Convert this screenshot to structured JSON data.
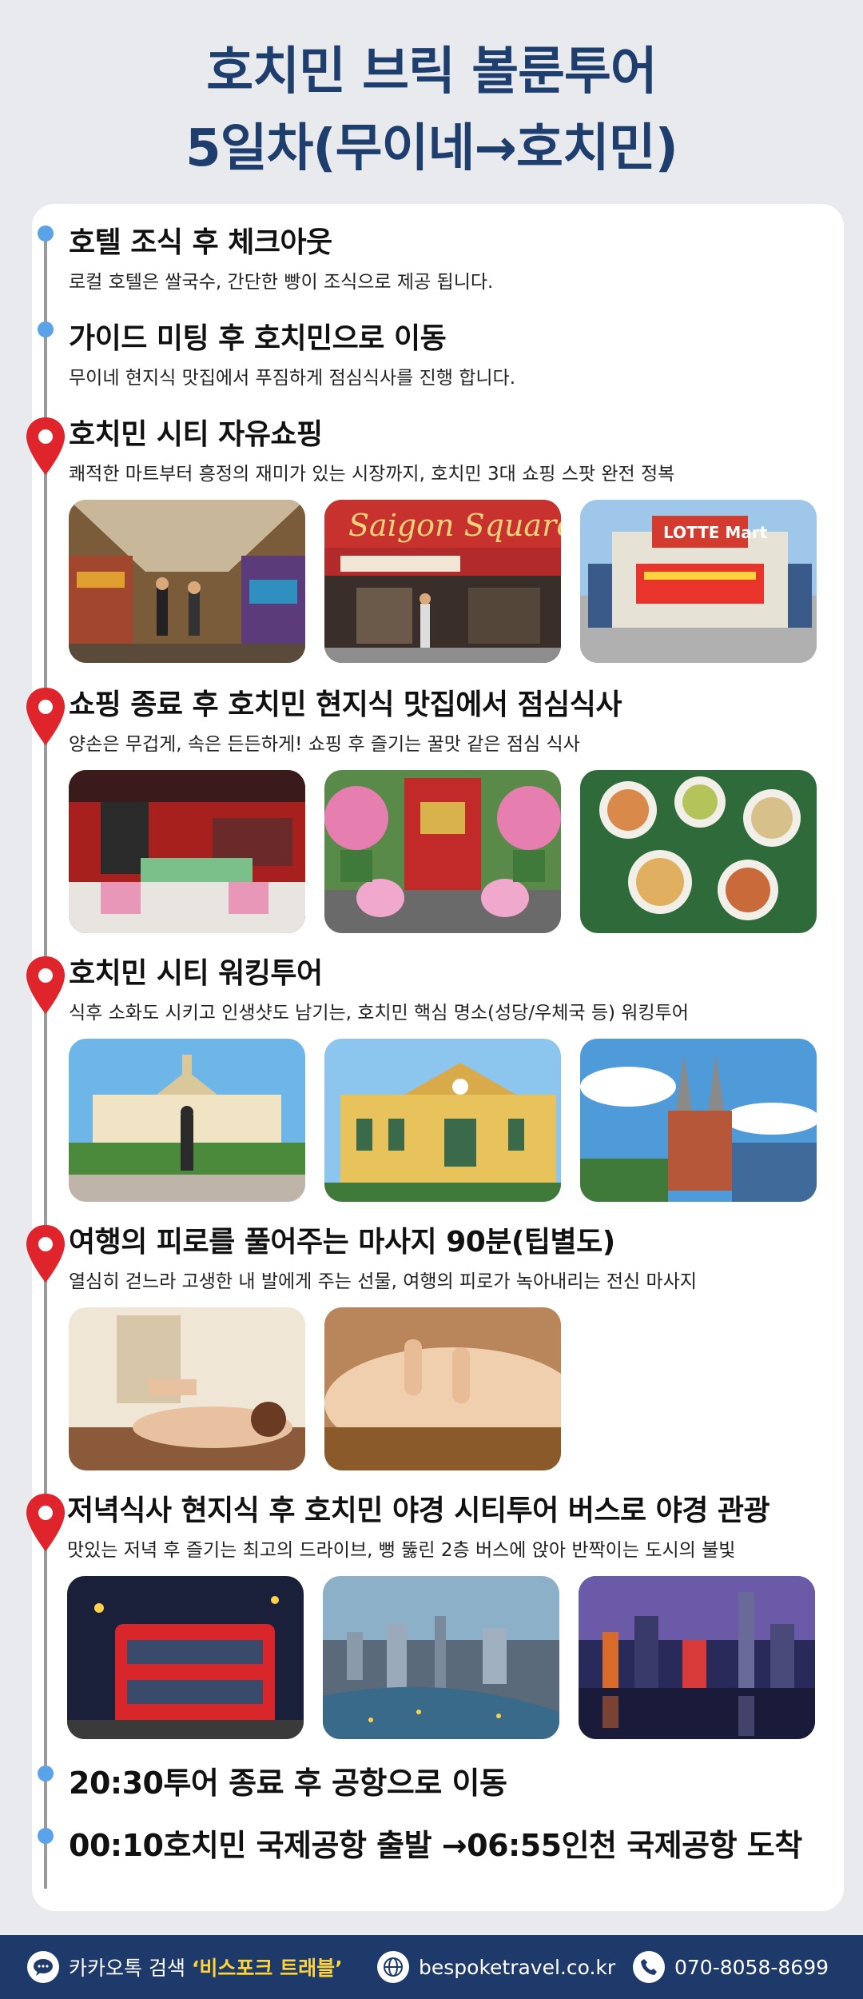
{
  "title": {
    "line1": "호치민 브릭 볼룬투어",
    "line2": "5일차(무이네→호치민)"
  },
  "items": [
    {
      "title": "호텔 조식 후 체크아웃",
      "desc": "로컬 호텔은 쌀국수, 간단한 빵이 조식으로 제공 됩니다.",
      "marker": "dot"
    },
    {
      "title": "가이드 미팅 후 호치민으로 이동",
      "desc": "무이네 현지식 맛집에서 푸짐하게 점심식사를 진행 합니다.",
      "marker": "dot"
    },
    {
      "title": "호치민 시티 자유쇼핑",
      "desc": "쾌적한 마트부터 흥정의 재미가 있는 시장까지, 호치민 3대 쇼핑 스팟 완전 정복",
      "marker": "pin",
      "photos": [
        "market-photo",
        "saigon-square-photo",
        "lotte-mart-photo"
      ]
    },
    {
      "title": "쇼핑 종료 후 호치민 현지식 맛집에서 점심식사",
      "desc": "양손은 무겁게, 속은 든든하게! 쇼핑 후 즐기는 꿀맛 같은 점심 식사",
      "marker": "pin",
      "photos": [
        "restaurant-interior-photo",
        "restaurant-entrance-photo",
        "vietnamese-food-photo"
      ]
    },
    {
      "title": "호치민 시티 워킹투어",
      "desc": "식후 소화도 시키고 인생샷도 남기는, 호치민 핵심 명소(성당/우체국 등) 워킹투어",
      "marker": "pin",
      "photos": [
        "city-hall-photo",
        "post-office-photo",
        "cathedral-photo"
      ]
    },
    {
      "title": "여행의 피로를 풀어주는 마사지 90분(팁별도)",
      "desc": "열심히 걷느라 고생한 내 발에게 주는 선물, 여행의 피로가 녹아내리는 전신 마사지",
      "marker": "pin",
      "photos": [
        "massage-photo-1",
        "massage-photo-2"
      ]
    },
    {
      "title": "저녁식사 현지식 후 호치민 야경 시티투어 버스로 야경 관광",
      "desc": "맛있는 저녁 후 즐기는 최고의 드라이브, 뻥 뚫린 2층 버스에 앉아 반짝이는 도시의 불빛",
      "marker": "pin",
      "photos": [
        "bus-tour-photo",
        "aerial-city-photo",
        "night-skyline-photo"
      ]
    },
    {
      "title": "20:30투어 종료 후 공항으로 이동",
      "desc": "",
      "marker": "dot"
    },
    {
      "title": "00:10호치민 국제공항 출발 →06:55인천 국제공항 도착",
      "desc": "",
      "marker": "dot"
    }
  ],
  "footer": {
    "kakao_prefix": "카카오톡 검색 ",
    "kakao_highlight": "‘비스포크 트래블’",
    "website": "bespoketravel.co.kr",
    "phone": "070-8058-8699"
  },
  "colors": {
    "title": "#1e3f6e",
    "dot": "#5aa3e8",
    "pin": "#e0242b",
    "footer_bg": "#1e3a6b",
    "footer_highlight": "#ffd43b"
  }
}
